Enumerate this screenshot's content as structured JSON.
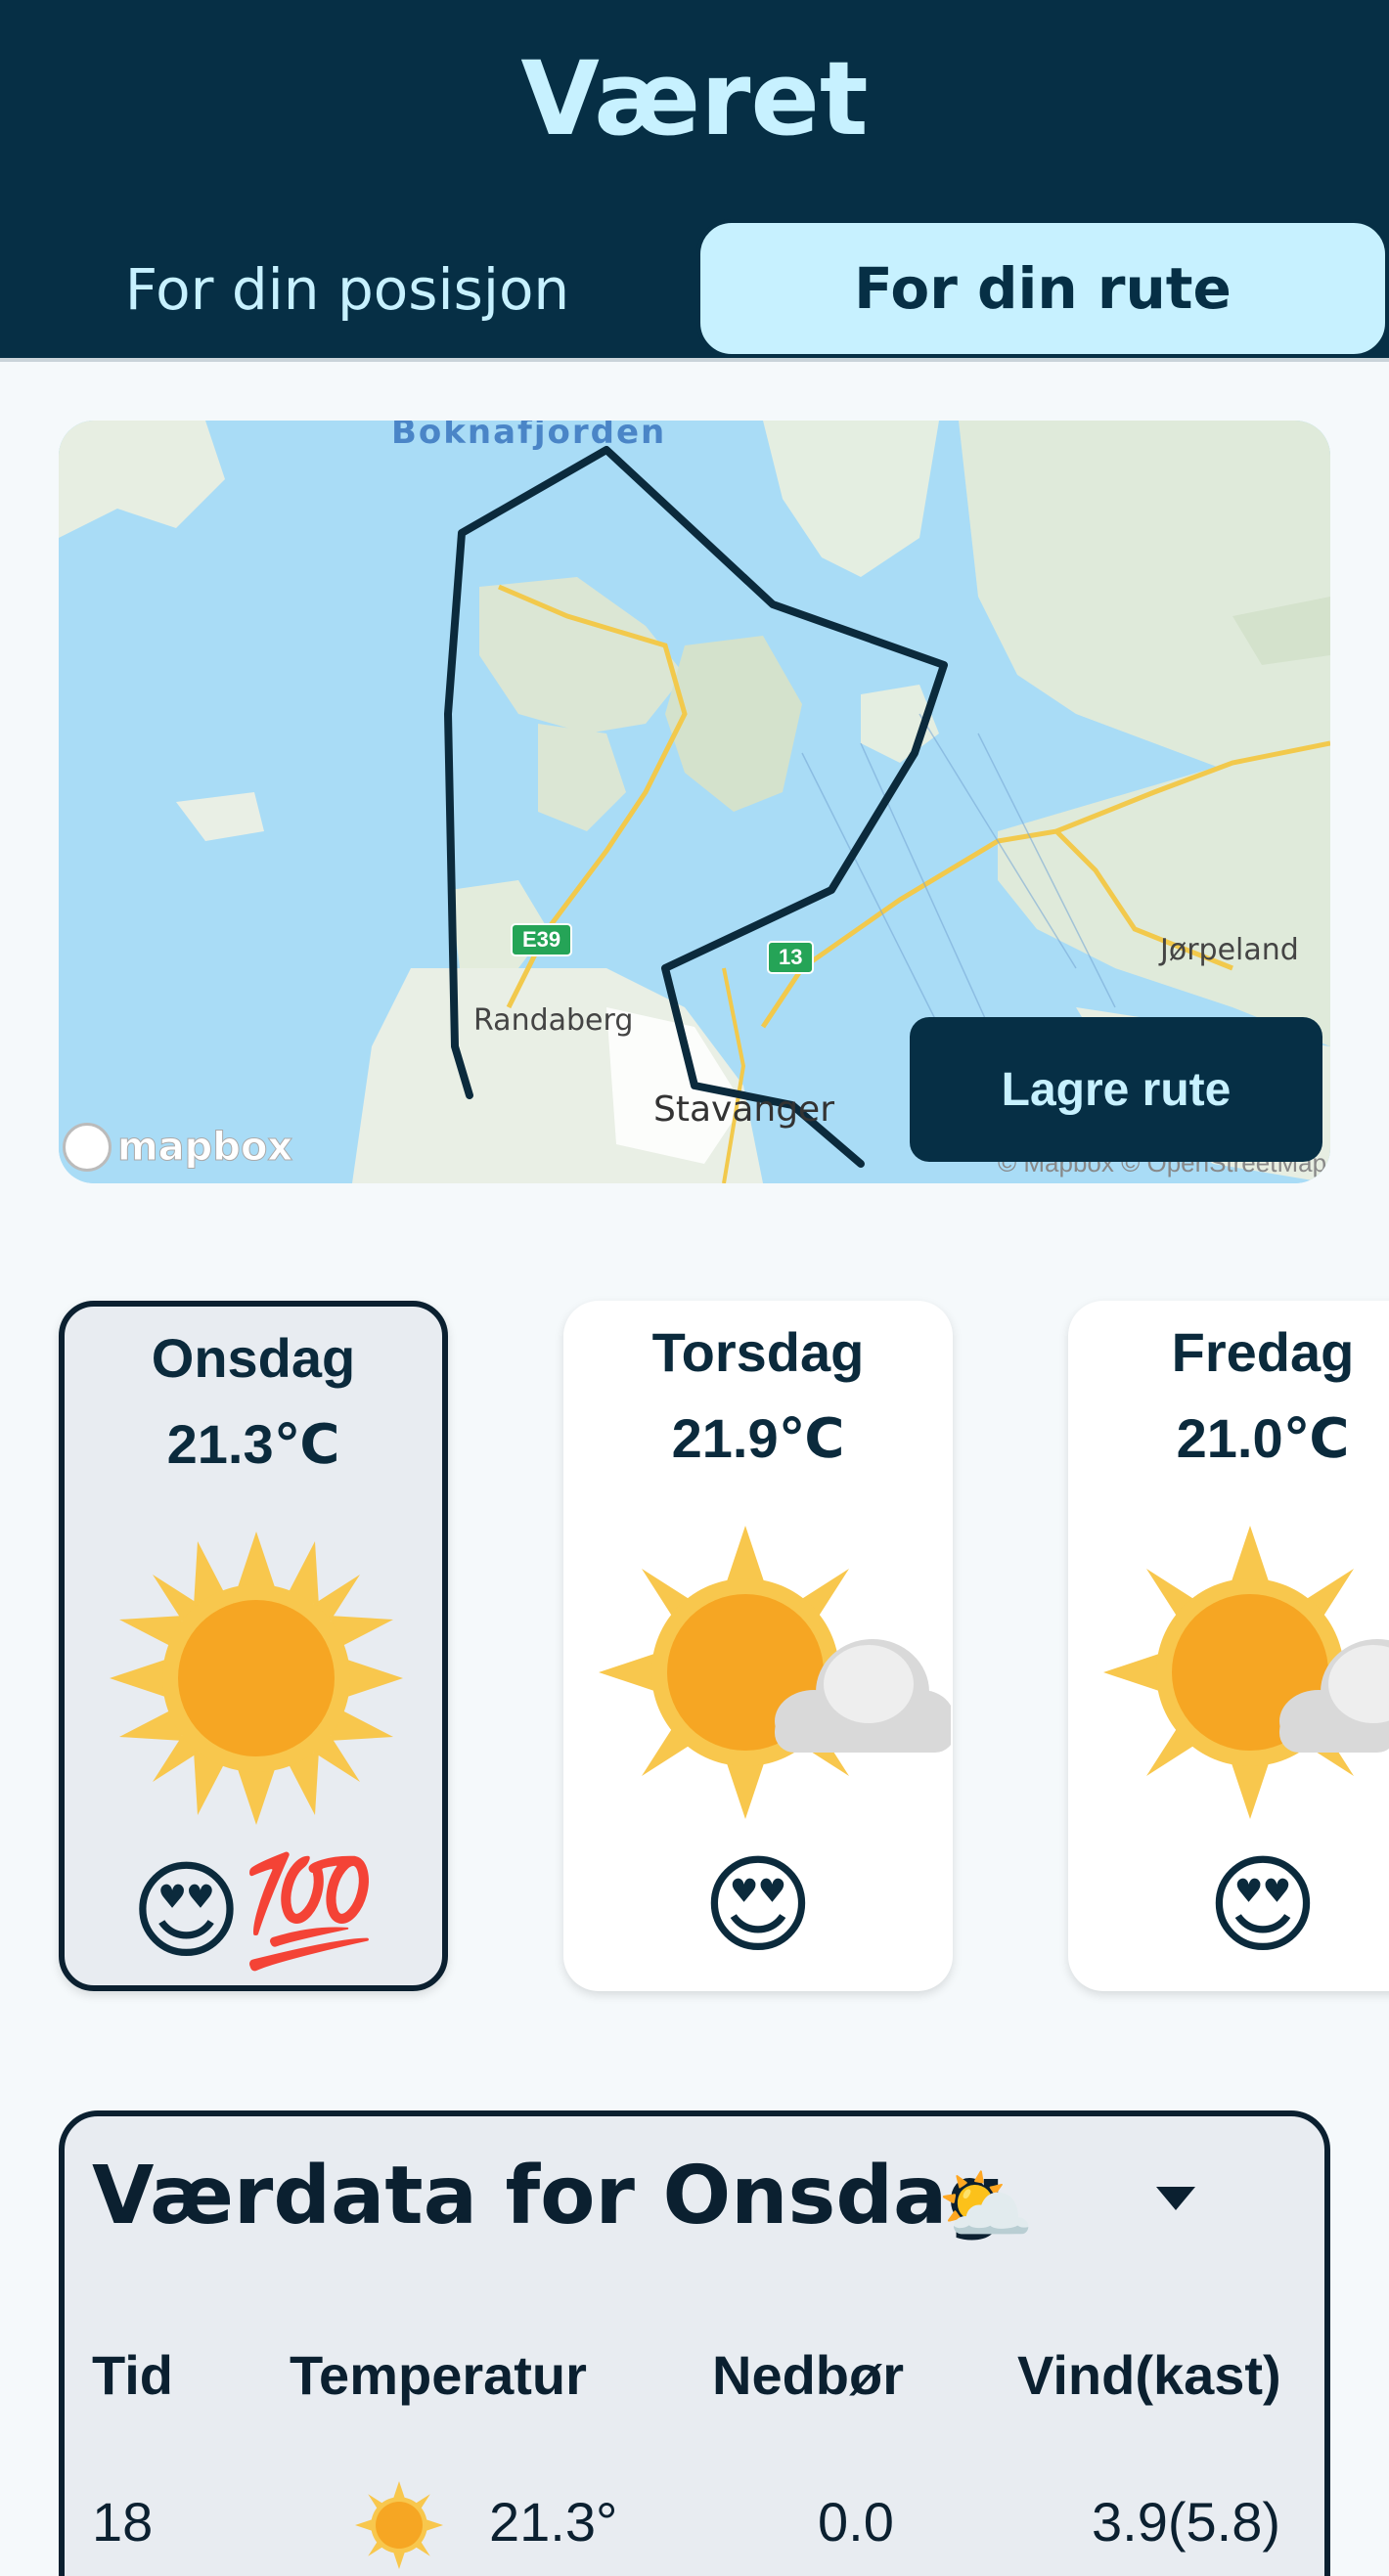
{
  "app": {
    "title": "Været"
  },
  "tabs": [
    {
      "label": "For din posisjon",
      "active": false
    },
    {
      "label": "For din rute",
      "active": true
    }
  ],
  "map": {
    "labels": {
      "randaberg": "Randaberg",
      "stavanger": "Stavanger",
      "jorpeland": "Jørpeland",
      "fjord": "Boknafjorden"
    },
    "road_badges": {
      "e39": "E39",
      "r13": "13"
    },
    "logo": "mapbox",
    "attribution": "© Mapbox © OpenStreetMap",
    "save_button": "Lagre rute"
  },
  "days": [
    {
      "name": "Onsdag",
      "temp": "21.3℃",
      "icon": "sun-icon",
      "emoji": "😍💯",
      "selected": true
    },
    {
      "name": "Torsdag",
      "temp": "21.9℃",
      "icon": "sun-cloud-icon",
      "emoji": "😍",
      "selected": false
    },
    {
      "name": "Fredag",
      "temp": "21.0℃",
      "icon": "sun-cloud-icon",
      "emoji": "😍",
      "selected": false
    }
  ],
  "weather_table": {
    "title": "Værdata for Onsdag",
    "title_emoji": "⛅",
    "headers": {
      "time": "Tid",
      "temp": "Temperatur",
      "precip": "Nedbør",
      "wind": "Vind(kast)"
    },
    "rows": [
      {
        "time": "18",
        "icon": "sun-icon",
        "temp": "21.3°",
        "precip": "0.0",
        "wind": "3.9(5.8)"
      }
    ]
  },
  "colors": {
    "header_bg": "#062f45",
    "accent": "#c7f1ff",
    "route_line": "#0b2a3c",
    "sun": "#f6a623"
  }
}
